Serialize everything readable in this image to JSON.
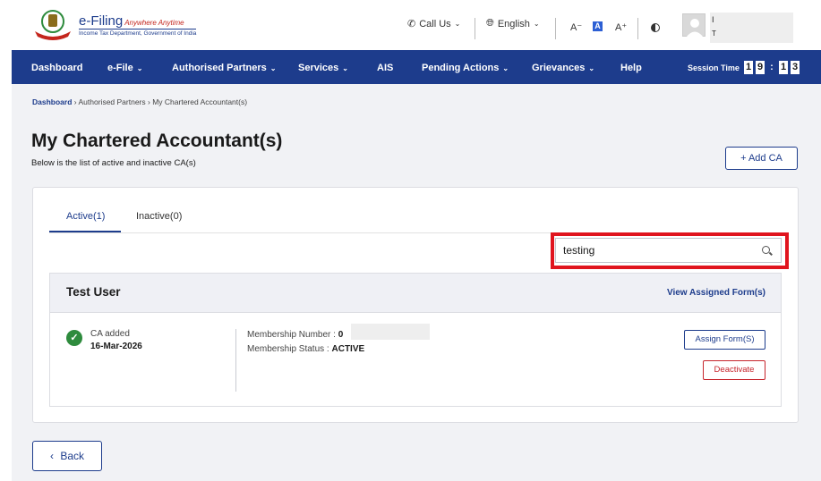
{
  "header": {
    "logo": {
      "brand": "e-Filing",
      "tagline": "Anywhere Anytime",
      "subtitle": "Income Tax Department, Government of India"
    },
    "call_us": "Call Us",
    "language": "English",
    "font_decrease": "A⁻",
    "font_normal": "A",
    "font_increase": "A⁺",
    "user_initial": "I",
    "user_sub": "T"
  },
  "nav": {
    "items": [
      {
        "label": "Dashboard",
        "has_caret": false
      },
      {
        "label": "e-File",
        "has_caret": true
      },
      {
        "label": "Authorised Partners",
        "has_caret": true
      },
      {
        "label": "Services",
        "has_caret": true
      },
      {
        "label": "AIS",
        "has_caret": false
      },
      {
        "label": "Pending Actions",
        "has_caret": true
      },
      {
        "label": "Grievances",
        "has_caret": true
      },
      {
        "label": "Help",
        "has_caret": false
      }
    ],
    "session_label": "Session Time",
    "session_digits": [
      "1",
      "9",
      ":",
      "1",
      "3"
    ]
  },
  "breadcrumb": {
    "items": [
      "Dashboard",
      "Authorised Partners",
      "My Chartered Accountant(s)"
    ]
  },
  "page": {
    "title": "My Chartered Accountant(s)",
    "subtitle": "Below is the list of active and inactive CA(s)",
    "add_button": "+ Add CA"
  },
  "tabs": [
    {
      "label": "Active(1)",
      "active": true
    },
    {
      "label": "Inactive(0)",
      "active": false
    }
  ],
  "search": {
    "value": "testing",
    "placeholder": ""
  },
  "ca_card": {
    "name": "Test User",
    "view_link": "View Assigned Form(s)",
    "added_label": "CA added",
    "added_date": "16-Mar-2026",
    "membership_number_label": "Membership Number :",
    "membership_number_value": "0",
    "membership_status_label": "Membership Status :",
    "membership_status_value": "ACTIVE",
    "assign_button": "Assign Form(S)",
    "deactivate_button": "Deactivate"
  },
  "back_button": "Back",
  "colors": {
    "primary": "#1d3c8c",
    "danger": "#c6252c",
    "success": "#2e8b3d",
    "highlight": "#e0141e"
  },
  "icons": [
    "phone-icon",
    "globe-icon",
    "search-icon",
    "check-circle-icon",
    "contrast-icon",
    "chevron-left-icon"
  ]
}
